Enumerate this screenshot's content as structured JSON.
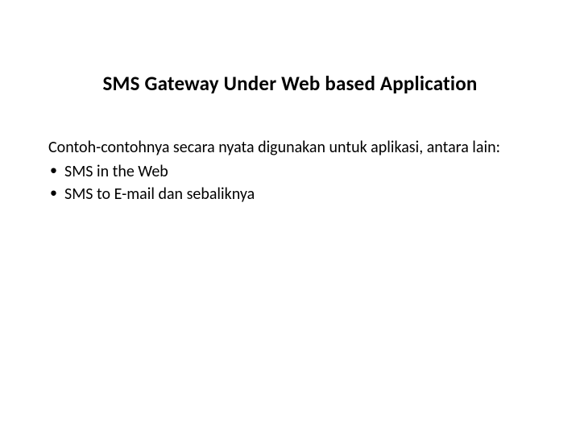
{
  "slide": {
    "title": "SMS Gateway Under Web based Application",
    "intro": "Contoh-contohnya secara nyata digunakan untuk aplikasi, antara lain:",
    "bullets": [
      "SMS in the Web",
      "SMS to E-mail dan sebaliknya"
    ]
  }
}
